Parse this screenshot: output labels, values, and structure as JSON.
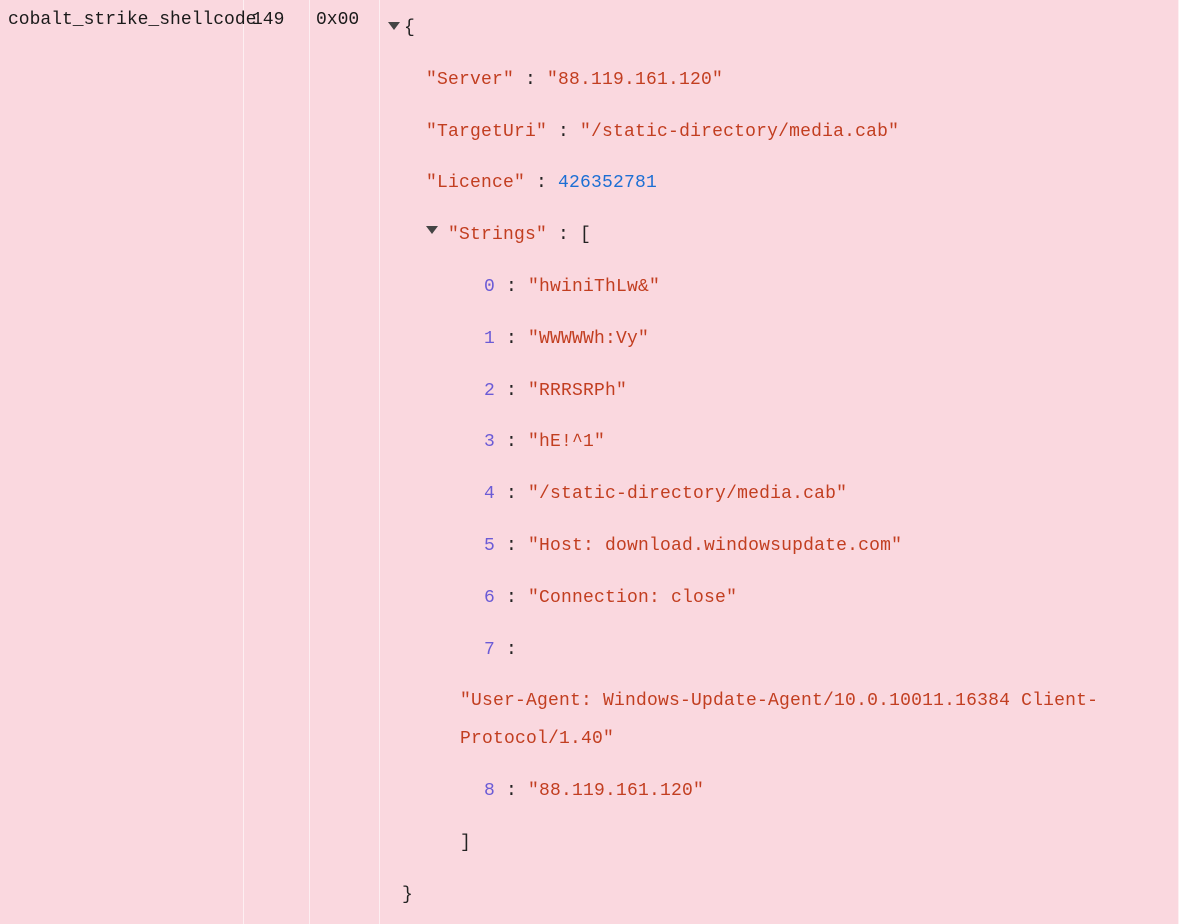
{
  "rule_name": "cobalt_strike_shellcode",
  "count": "149",
  "flag": "0x00",
  "json": {
    "server_key": "\"Server\"",
    "server_val": "\"88.119.161.120\"",
    "targeturi_key": "\"TargetUri\"",
    "targeturi_val": "\"/static-directory/media.cab\"",
    "licence_key": "\"Licence\"",
    "licence_val": "426352781",
    "strings_key": "\"Strings\"",
    "open_bracket": "[",
    "close_bracket": "]",
    "open_brace": "{",
    "close_brace": "}",
    "colon": " : ",
    "items": [
      {
        "idx": "0",
        "val": "\"hwiniThLw&\""
      },
      {
        "idx": "1",
        "val": "\"WWWWWh:Vy\""
      },
      {
        "idx": "2",
        "val": "\"RRRSRPh\""
      },
      {
        "idx": "3",
        "val": "\"hE!^1\""
      },
      {
        "idx": "4",
        "val": "\"/static-directory/media.cab\""
      },
      {
        "idx": "5",
        "val": "\"Host: download.windowsupdate.com\""
      },
      {
        "idx": "6",
        "val": "\"Connection: close\""
      },
      {
        "idx": "7",
        "val": "\"User-Agent: Windows-Update-Agent/10.0.10011.16384 Client-Protocol/1.40\""
      },
      {
        "idx": "8",
        "val": "\"88.119.161.120\""
      }
    ]
  }
}
